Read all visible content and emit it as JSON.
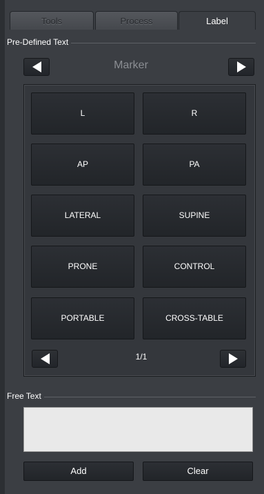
{
  "tabs": [
    {
      "label": "Tools",
      "active": false
    },
    {
      "label": "Process",
      "active": false
    },
    {
      "label": "Label",
      "active": true
    }
  ],
  "predefined": {
    "group_label": "Pre-Defined Text",
    "category": "Marker",
    "buttons": [
      "L",
      "R",
      "AP",
      "PA",
      "LATERAL",
      "SUPINE",
      "PRONE",
      "CONTROL",
      "PORTABLE",
      "CROSS-TABLE"
    ],
    "page_indicator": "1/1"
  },
  "free_text": {
    "group_label": "Free Text",
    "value": ""
  },
  "actions": {
    "add_label": "Add",
    "clear_label": "Clear"
  },
  "colors": {
    "panel_bg": "#3b3e43",
    "button_bg": "#24272b",
    "text_field_bg": "#e9e9e9"
  }
}
